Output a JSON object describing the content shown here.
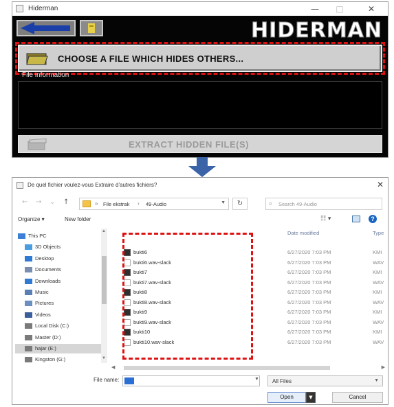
{
  "hiderman": {
    "window_title": "Hiderman",
    "controls": {
      "minimize": "—",
      "maximize": "□",
      "close": "✕"
    },
    "brand": "HIDERMAN",
    "choose_button": "CHOOSE A FILE WHICH HIDES OTHERS...",
    "info_label": "File information",
    "extract_button": "EXTRACT HIDDEN FILE(S)"
  },
  "dialog": {
    "title": "De quel fichier voulez-vous Extraire d'autres fichiers?",
    "close": "✕",
    "nav": {
      "back": "←",
      "forward": "→",
      "recent": "⌄",
      "up": "↑",
      "refresh": "↻"
    },
    "breadcrumb": [
      "File ekstrak",
      "49-Audio"
    ],
    "search_placeholder": "Search 49-Audio",
    "toolbar": {
      "organize": "Organize ▾",
      "new_folder": "New folder",
      "view": "☷ ▾",
      "help": "?"
    },
    "sidebar": [
      {
        "label": "This PC",
        "icon": "pc-icon",
        "color": "#3b7fd6"
      },
      {
        "label": "3D Objects",
        "icon": "3d-objects-icon",
        "color": "#4a9ee0"
      },
      {
        "label": "Desktop",
        "icon": "desktop-icon",
        "color": "#2f7ad3"
      },
      {
        "label": "Documents",
        "icon": "documents-icon",
        "color": "#7a8fb0"
      },
      {
        "label": "Downloads",
        "icon": "downloads-icon",
        "color": "#2f7ad3"
      },
      {
        "label": "Music",
        "icon": "music-icon",
        "color": "#5a7fb5"
      },
      {
        "label": "Pictures",
        "icon": "pictures-icon",
        "color": "#6a8fc0"
      },
      {
        "label": "Videos",
        "icon": "videos-icon",
        "color": "#3a5f9a"
      },
      {
        "label": "Local Disk (C:)",
        "icon": "drive-icon",
        "color": "#7a7a7a"
      },
      {
        "label": "Master (D:)",
        "icon": "drive-icon",
        "color": "#7a7a7a"
      },
      {
        "label": "hajar (E:)",
        "icon": "drive-icon",
        "color": "#7a7a7a",
        "selected": true
      },
      {
        "label": "Kingston (G:)",
        "icon": "drive-icon",
        "color": "#7a7a7a"
      }
    ],
    "columns": {
      "date": "Date modified",
      "type": "Type"
    },
    "files": [
      {
        "name": "bukti6",
        "date": "6/27/2020 7:03 PM",
        "type": "KMI",
        "kind": "exe"
      },
      {
        "name": "bukti6.wav-slack",
        "date": "6/27/2020 7:03 PM",
        "type": "WAV",
        "kind": "doc"
      },
      {
        "name": "bukti7",
        "date": "6/27/2020 7:03 PM",
        "type": "KMI",
        "kind": "exe"
      },
      {
        "name": "bukti7.wav-slack",
        "date": "6/27/2020 7:03 PM",
        "type": "WAV",
        "kind": "doc"
      },
      {
        "name": "bukti8",
        "date": "6/27/2020 7:03 PM",
        "type": "KMI",
        "kind": "exe"
      },
      {
        "name": "bukti8.wav-slack",
        "date": "6/27/2020 7:03 PM",
        "type": "WAV",
        "kind": "doc"
      },
      {
        "name": "bukti9",
        "date": "6/27/2020 7:03 PM",
        "type": "KMI",
        "kind": "exe"
      },
      {
        "name": "bukti9.wav-slack",
        "date": "6/27/2020 7:03 PM",
        "type": "WAV",
        "kind": "doc"
      },
      {
        "name": "bukti10",
        "date": "6/27/2020 7:03 PM",
        "type": "KMI",
        "kind": "exe"
      },
      {
        "name": "bukti10.wav-slack",
        "date": "6/27/2020 7:03 PM",
        "type": "WAV",
        "kind": "doc"
      }
    ],
    "filename_label": "File name:",
    "filter": "All Files",
    "open_button": "Open",
    "cancel_button": "Cancel"
  },
  "colors": {
    "highlight": "#dd1111",
    "arrow": "#3a63a8",
    "hiderman_bg": "#050505"
  }
}
